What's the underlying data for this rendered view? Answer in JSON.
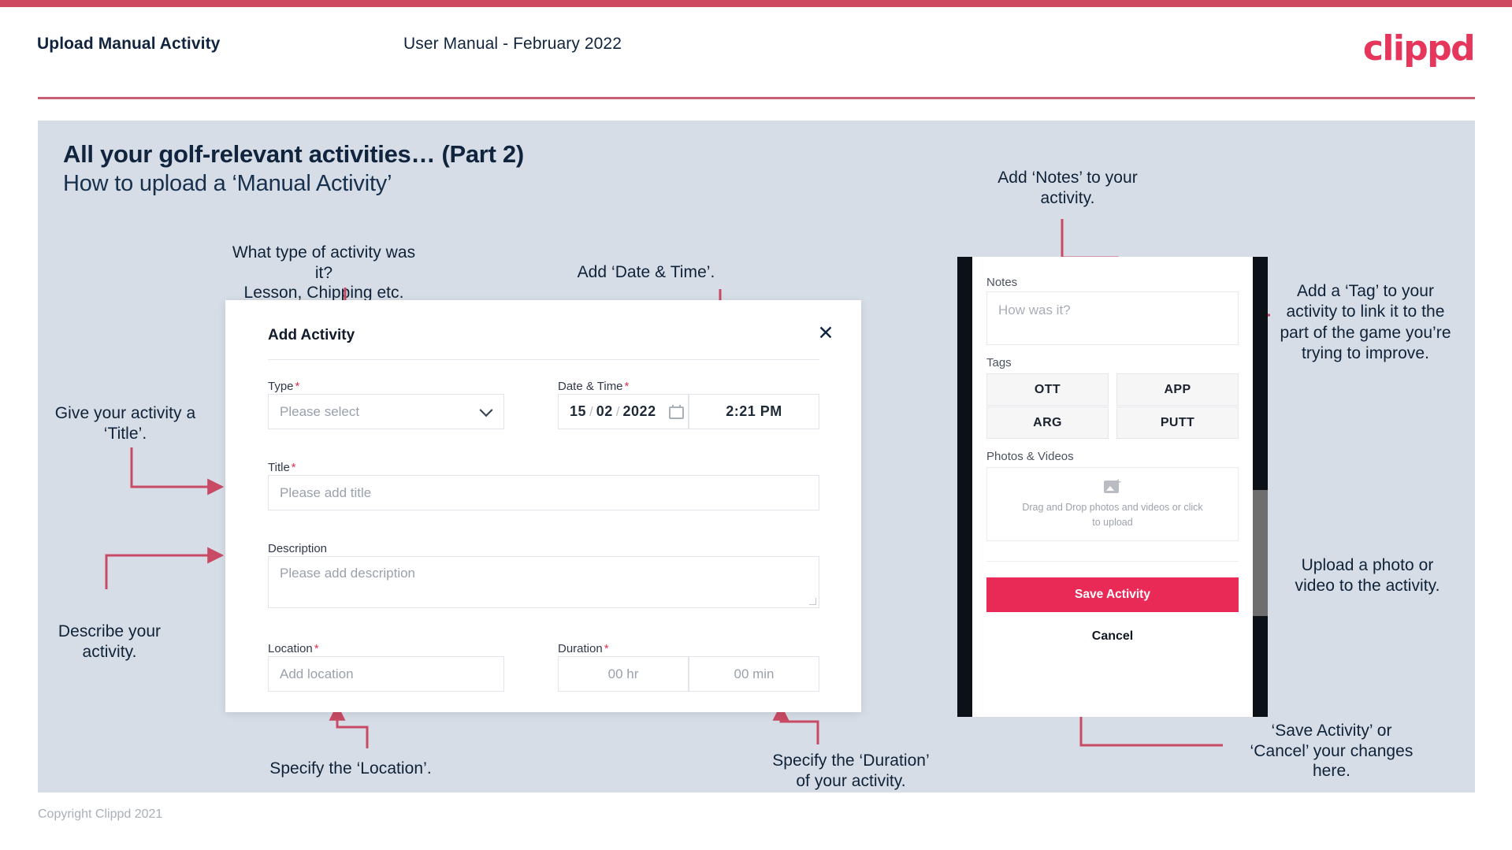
{
  "header": {
    "title": "Upload Manual Activity",
    "subtitle": "User Manual - February 2022",
    "logo": "clippd"
  },
  "slide": {
    "title": "All your golf-relevant activities… (Part 2)",
    "subtitle": "How to upload a ‘Manual Activity’"
  },
  "annotations": {
    "type": "What type of activity was it?\nLesson, Chipping etc.",
    "datetime": "Add ‘Date & Time’.",
    "title": "Give your activity a\n‘Title’.",
    "description": "Describe your\nactivity.",
    "location": "Specify the ‘Location’.",
    "duration": "Specify the ‘Duration’\nof your activity.",
    "notes": "Add ‘Notes’ to your\nactivity.",
    "tags": "Add a ‘Tag’ to your activity to link it to the part of the game you’re trying to improve.",
    "upload": "Upload a photo or\nvideo to the activity.",
    "save_cancel": "‘Save Activity’ or\n‘Cancel’ your changes\nhere."
  },
  "dialog": {
    "title": "Add Activity",
    "close_icon": "close-icon",
    "fields": {
      "type": {
        "label": "Type",
        "required": "*",
        "placeholder": "Please select"
      },
      "datetime": {
        "label": "Date & Time",
        "required": "*",
        "day": "15",
        "month": "02",
        "year": "2022",
        "sep": "/",
        "time": "2:21 PM"
      },
      "title": {
        "label": "Title",
        "required": "*",
        "placeholder": "Please add title"
      },
      "description": {
        "label": "Description",
        "required": "",
        "placeholder": "Please add description"
      },
      "location": {
        "label": "Location",
        "required": "*",
        "placeholder": "Add location"
      },
      "duration": {
        "label": "Duration",
        "required": "*",
        "hours_placeholder": "00 hr",
        "minutes_placeholder": "00 min"
      }
    }
  },
  "phone": {
    "notes": {
      "label": "Notes",
      "placeholder": "How was it?"
    },
    "tags": {
      "label": "Tags",
      "items": [
        "OTT",
        "APP",
        "ARG",
        "PUTT"
      ]
    },
    "photos": {
      "label": "Photos & Videos",
      "upload_text": "Drag and Drop photos and videos or click to upload",
      "upload_icon": "add-image-icon"
    },
    "save_label": "Save Activity",
    "cancel_label": "Cancel"
  },
  "footer": {
    "copyright": "Copyright Clippd 2021"
  },
  "colors": {
    "accent": "#cd4a61",
    "brand": "#e6365c",
    "save_button": "#ea2a56",
    "slide_bg": "#d6dde6",
    "text_dark": "#10243e"
  }
}
